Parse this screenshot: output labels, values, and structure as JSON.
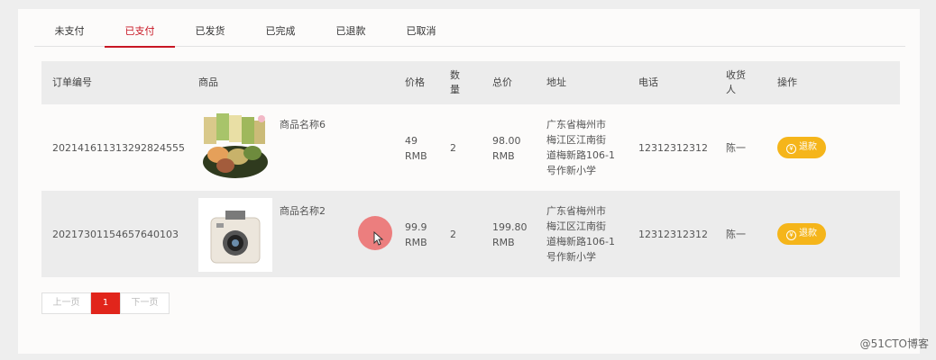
{
  "tabs": [
    "未支付",
    "已支付",
    "已发货",
    "已完成",
    "已退款",
    "已取消"
  ],
  "active_tab": "已支付",
  "columns": {
    "order_no": "订单编号",
    "product": "商品",
    "price": "价格",
    "qty_line1": "数",
    "qty_line2": "量",
    "total": "总价",
    "address": "地址",
    "phone": "电话",
    "receiver_line1": "收货",
    "receiver_line2": "人",
    "action": "操作"
  },
  "orders": [
    {
      "order_no": "202141611313292824555",
      "product_name": "商品名称6",
      "price": "49",
      "price_unit": "RMB",
      "qty": "2",
      "total": "98.00",
      "total_unit": "RMB",
      "address_lines": [
        "广东省梅州市",
        "梅江区江南街",
        "道梅新路106-1",
        "号作新小学"
      ],
      "phone": "12312312312",
      "receiver": "陈一",
      "action": "退款"
    },
    {
      "order_no": "20217301154657640103",
      "product_name": "商品名称2",
      "price": "99.9",
      "price_unit": "RMB",
      "qty": "2",
      "total": "199.80",
      "total_unit": "RMB",
      "address_lines": [
        "广东省梅州市",
        "梅江区江南街",
        "道梅新路106-1",
        "号作新小学"
      ],
      "phone": "12312312312",
      "receiver": "陈一",
      "action": "退款"
    }
  ],
  "pagination": {
    "prev": "上一页",
    "current": "1",
    "next": "下一页"
  },
  "watermark": "@51CTO博客",
  "colors": {
    "accent": "#c81623",
    "refund": "#f5b51a",
    "page_current": "#e1251b"
  },
  "icons": {
    "refund": "yen-icon"
  }
}
